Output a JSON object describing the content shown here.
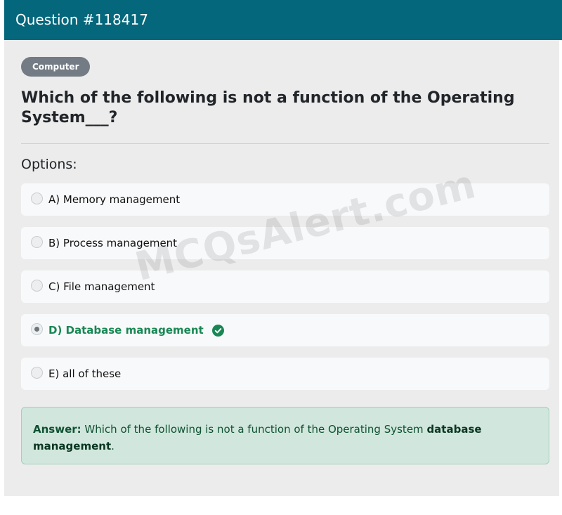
{
  "header": {
    "title": "Question #118417"
  },
  "category_badge": "Computer",
  "question": {
    "text_line1": "Which of the following is not a function of the Operating",
    "text_line2": "System___?"
  },
  "options_label": "Options:",
  "options": [
    {
      "label": "A) Memory management",
      "selected": false,
      "correct": false
    },
    {
      "label": "B) Process management",
      "selected": false,
      "correct": false
    },
    {
      "label": "C) File management",
      "selected": false,
      "correct": false
    },
    {
      "label": "D) Database management",
      "selected": true,
      "correct": true
    },
    {
      "label": "E) all of these",
      "selected": false,
      "correct": false
    }
  ],
  "answer": {
    "label": "Answer:",
    "text": " Which of the following is not a function of the Operating System ",
    "value": "database management",
    "period": "."
  },
  "watermark": "MCQsAlert.com",
  "colors": {
    "header_bg": "#04677b",
    "correct_green": "#198754",
    "answer_bg": "#d1e7dd"
  }
}
